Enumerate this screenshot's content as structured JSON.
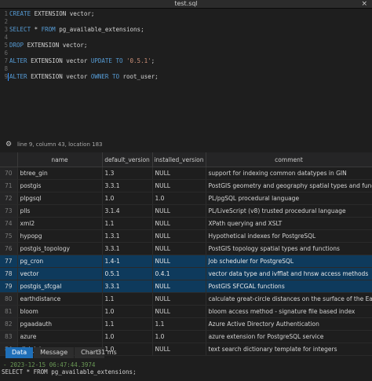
{
  "window": {
    "title": "test.sql",
    "close_glyph": "×"
  },
  "editor": {
    "lines": [
      {
        "n": "1",
        "parts": [
          {
            "t": "CREATE",
            "k": "kw"
          },
          {
            "t": " EXTENSION vector;",
            "k": ""
          }
        ]
      },
      {
        "n": "2",
        "parts": []
      },
      {
        "n": "3",
        "parts": [
          {
            "t": "SELECT",
            "k": "kw"
          },
          {
            "t": " * ",
            "k": ""
          },
          {
            "t": "FROM",
            "k": "kw"
          },
          {
            "t": " pg_available_extensions;",
            "k": ""
          }
        ]
      },
      {
        "n": "4",
        "parts": []
      },
      {
        "n": "5",
        "parts": [
          {
            "t": "DROP",
            "k": "kw"
          },
          {
            "t": " EXTENSION vector;",
            "k": ""
          }
        ]
      },
      {
        "n": "6",
        "parts": []
      },
      {
        "n": "7",
        "parts": [
          {
            "t": "ALTER",
            "k": "kw"
          },
          {
            "t": " EXTENSION vector ",
            "k": ""
          },
          {
            "t": "UPDATE TO",
            "k": "kw"
          },
          {
            "t": " ",
            "k": ""
          },
          {
            "t": "'0.5.1'",
            "k": "str"
          },
          {
            "t": ";",
            "k": ""
          }
        ]
      },
      {
        "n": "8",
        "parts": []
      },
      {
        "n": "9",
        "parts": [
          {
            "t": "ALTER",
            "k": "kw"
          },
          {
            "t": " EXTENSION vector ",
            "k": ""
          },
          {
            "t": "OWNER TO",
            "k": "kw"
          },
          {
            "t": " root_user;",
            "k": ""
          }
        ]
      }
    ]
  },
  "status": {
    "gear_icon": "gear-icon",
    "text": "line 9, column 43, location 183"
  },
  "results": {
    "columns": [
      "",
      "name",
      "default_version",
      "installed_version",
      "comment"
    ],
    "rows": [
      {
        "n": "70",
        "name": "btree_gin",
        "default": "1.3",
        "installed": "NULL",
        "comment": "support for indexing common datatypes in GIN",
        "selected": false
      },
      {
        "n": "71",
        "name": "postgis",
        "default": "3.3.1",
        "installed": "NULL",
        "comment": "PostGIS geometry and geography spatial types and functions",
        "selected": false
      },
      {
        "n": "72",
        "name": "plpgsql",
        "default": "1.0",
        "installed": "1.0",
        "comment": "PL/pgSQL procedural language",
        "selected": false
      },
      {
        "n": "73",
        "name": "plls",
        "default": "3.1.4",
        "installed": "NULL",
        "comment": "PL/LiveScript (v8) trusted procedural language",
        "selected": false
      },
      {
        "n": "74",
        "name": "xml2",
        "default": "1.1",
        "installed": "NULL",
        "comment": "XPath querying and XSLT",
        "selected": false
      },
      {
        "n": "75",
        "name": "hypopg",
        "default": "1.3.1",
        "installed": "NULL",
        "comment": "Hypothetical indexes for PostgreSQL",
        "selected": false
      },
      {
        "n": "76",
        "name": "postgis_topology",
        "default": "3.3.1",
        "installed": "NULL",
        "comment": "PostGIS topology spatial types and functions",
        "selected": false
      },
      {
        "n": "77",
        "name": "pg_cron",
        "default": "1.4-1",
        "installed": "NULL",
        "comment": "Job scheduler for PostgreSQL",
        "selected": true
      },
      {
        "n": "78",
        "name": "vector",
        "default": "0.5.1",
        "installed": "0.4.1",
        "comment": "vector data type and ivfflat and hnsw access methods",
        "selected": true
      },
      {
        "n": "79",
        "name": "postgis_sfcgal",
        "default": "3.3.1",
        "installed": "NULL",
        "comment": "PostGIS SFCGAL functions",
        "selected": true
      },
      {
        "n": "80",
        "name": "earthdistance",
        "default": "1.1",
        "installed": "NULL",
        "comment": "calculate great-circle distances on the surface of the Earth",
        "selected": false
      },
      {
        "n": "81",
        "name": "bloom",
        "default": "1.0",
        "installed": "NULL",
        "comment": "bloom access method - signature file based index",
        "selected": false
      },
      {
        "n": "82",
        "name": "pgaadauth",
        "default": "1.1",
        "installed": "1.1",
        "comment": "Azure Active Directory Authentication",
        "selected": false
      },
      {
        "n": "83",
        "name": "azure",
        "default": "1.0",
        "installed": "1.0",
        "comment": "azure extension for PostgreSQL service",
        "selected": false
      },
      {
        "n": "84",
        "name": "dict_int",
        "default": "1.0",
        "installed": "NULL",
        "comment": "text search dictionary template for integers",
        "selected": false
      }
    ]
  },
  "tabs": [
    {
      "label": "Data",
      "active": true
    },
    {
      "label": "Message",
      "active": false
    },
    {
      "label": "Chart",
      "active": false
    }
  ],
  "timing": "31 ms",
  "log": {
    "timestamp": "- 2023-12-15 06:47:44.3974",
    "query": "SELECT * FROM pg_available_extensions;"
  },
  "colors": {
    "accent": "#1f6fb8",
    "selection": "#0e3a5c",
    "keyword": "#569cd6",
    "string": "#ce9178"
  }
}
